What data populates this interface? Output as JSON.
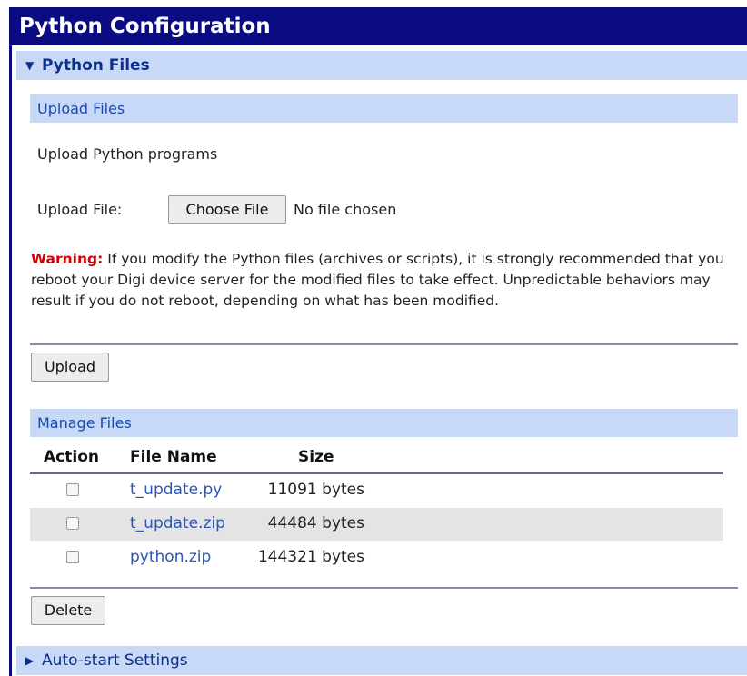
{
  "window": {
    "title": "Python Configuration"
  },
  "python_files": {
    "header": "Python Files",
    "upload_section": {
      "title": "Upload Files",
      "description": "Upload Python programs",
      "file_label": "Upload File:",
      "choose_button": "Choose File",
      "file_status": "No file chosen",
      "warning_label": "Warning:",
      "warning_text": " If you modify the Python files (archives or scripts), it is strongly recommended that you reboot your Digi device server for the modified files to take effect. Unpredictable behaviors may result if you do not reboot, depending on what has been modified.",
      "upload_button": "Upload"
    },
    "manage_section": {
      "title": "Manage Files",
      "columns": [
        "Action",
        "File Name",
        "Size"
      ],
      "rows": [
        {
          "name": "t_update.py",
          "size": "11091 bytes",
          "checked": false
        },
        {
          "name": "t_update.zip",
          "size": "44484 bytes",
          "checked": false
        },
        {
          "name": "python.zip",
          "size": "144321 bytes",
          "checked": false
        }
      ],
      "delete_button": "Delete"
    }
  },
  "auto_start": {
    "header": "Auto-start Settings"
  },
  "colors": {
    "title_bar": "#0b0b82",
    "section_header_bg": "#c8d9f7",
    "link": "#2a55b8",
    "warning": "#d40000"
  },
  "icons": {
    "expanded": "triangle-down-icon",
    "collapsed": "triangle-right-icon"
  }
}
